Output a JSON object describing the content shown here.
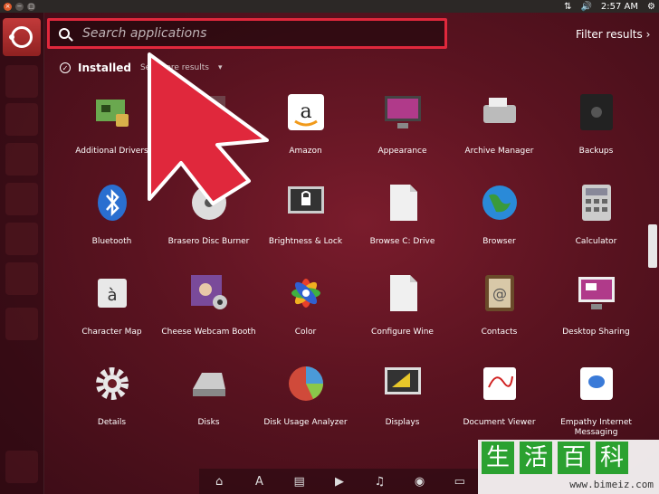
{
  "window_controls": {
    "close": "×",
    "minimize": "−",
    "maximize": "□"
  },
  "panel": {
    "time": "2:57 AM"
  },
  "search": {
    "placeholder": "Search applications"
  },
  "filter": {
    "label": "Filter results",
    "chevron": "›"
  },
  "installed": {
    "label": "Installed",
    "see_more": "See more results",
    "check": "✓"
  },
  "apps": [
    {
      "label": "Additional Drivers",
      "icon": "chip-icon",
      "color": "#6aa84f"
    },
    {
      "label": "...ware",
      "icon": "hidden-icon",
      "color": "#888888"
    },
    {
      "label": "Amazon",
      "icon": "amazon-icon",
      "color": "#ffffff"
    },
    {
      "label": "Appearance",
      "icon": "monitor-icon",
      "color": "#b03a8a"
    },
    {
      "label": "Archive Manager",
      "icon": "archive-icon",
      "color": "#bbbbbb"
    },
    {
      "label": "Backups",
      "icon": "safe-icon",
      "color": "#222222"
    },
    {
      "label": "Bluetooth",
      "icon": "bluetooth-icon",
      "color": "#2a6fd0"
    },
    {
      "label": "Brasero Disc Burner",
      "icon": "disc-icon",
      "color": "#dddddd"
    },
    {
      "label": "Brightness & Lock",
      "icon": "lock-screen-icon",
      "color": "#333333"
    },
    {
      "label": "Browse C: Drive",
      "icon": "document-icon",
      "color": "#f0f0f0"
    },
    {
      "label": "Browser",
      "icon": "globe-icon",
      "color": "#2a8ad8"
    },
    {
      "label": "Calculator",
      "icon": "calculator-icon",
      "color": "#cccccc"
    },
    {
      "label": "Character Map",
      "icon": "charmap-icon",
      "color": "#e8e8e8"
    },
    {
      "label": "Cheese Webcam Booth",
      "icon": "webcam-icon",
      "color": "#7a4a9a"
    },
    {
      "label": "Color",
      "icon": "color-icon",
      "color": "#e85a2a"
    },
    {
      "label": "Configure Wine",
      "icon": "document-icon",
      "color": "#f0f0f0"
    },
    {
      "label": "Contacts",
      "icon": "contacts-icon",
      "color": "#6a4a2a"
    },
    {
      "label": "Desktop Sharing",
      "icon": "desktop-sharing-icon",
      "color": "#b03a8a"
    },
    {
      "label": "Details",
      "icon": "gear-icon",
      "color": "#e8e8e8"
    },
    {
      "label": "Disks",
      "icon": "disk-icon",
      "color": "#cccccc"
    },
    {
      "label": "Disk Usage Analyzer",
      "icon": "pie-icon",
      "color": "#d04a3a"
    },
    {
      "label": "Displays",
      "icon": "displays-icon",
      "color": "#333333"
    },
    {
      "label": "Document Viewer",
      "icon": "pdf-icon",
      "color": "#ffffff"
    },
    {
      "label": "Empathy Internet Messaging",
      "icon": "empathy-icon",
      "color": "#ffffff"
    }
  ],
  "watermark": {
    "chars": [
      "生",
      "活",
      "百",
      "科"
    ],
    "url": "www.bimeiz.com"
  },
  "colors": {
    "accent": "#e0283c",
    "background": "#5a1320",
    "panel": "#2c2826"
  }
}
